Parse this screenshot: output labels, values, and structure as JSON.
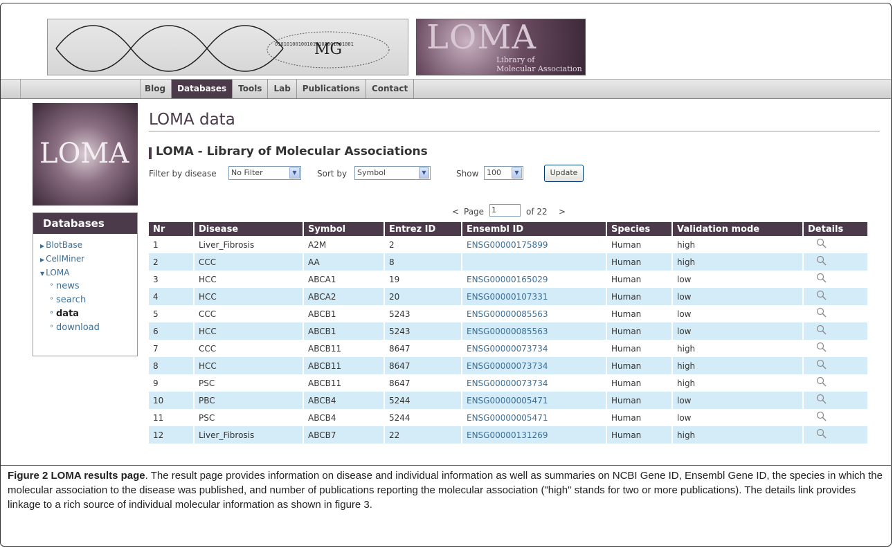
{
  "header": {
    "mg_logo_text": "MG",
    "mg_logo_binary": "010101001001010101001001001",
    "loma_banner_title": "LOMA",
    "loma_banner_sub1": "Library of",
    "loma_banner_sub2": "Molecular Association"
  },
  "nav": {
    "tabs": [
      {
        "label": "Blog"
      },
      {
        "label": "Databases"
      },
      {
        "label": "Tools"
      },
      {
        "label": "Lab"
      },
      {
        "label": "Publications"
      },
      {
        "label": "Contact"
      }
    ],
    "active": "Databases"
  },
  "sidebar": {
    "logo_text": "LOMA",
    "heading": "Databases",
    "items": [
      {
        "label": "BlotBase"
      },
      {
        "label": "CellMiner"
      },
      {
        "label": "LOMA"
      }
    ],
    "subitems": [
      {
        "label": "news"
      },
      {
        "label": "search"
      },
      {
        "label": "data"
      },
      {
        "label": "download"
      }
    ]
  },
  "main": {
    "page_title": "LOMA data",
    "subtitle": "LOMA - Library of Molecular Associations",
    "filter_label": "Filter by disease",
    "filter_value": "No Filter",
    "sort_label": "Sort by",
    "sort_value": "Symbol",
    "show_label": "Show",
    "show_value": "100",
    "update_label": "Update",
    "pager_prev": "<",
    "pager_page_label": "Page",
    "pager_page_value": "1",
    "pager_of": "of 22",
    "pager_next": ">"
  },
  "table": {
    "columns": [
      "Nr",
      "Disease",
      "Symbol",
      "Entrez ID",
      "Ensembl ID",
      "Species",
      "Validation mode",
      "Details"
    ],
    "rows": [
      [
        "1",
        "Liver_Fibrosis",
        "A2M",
        "2",
        "ENSG00000175899",
        "Human",
        "high"
      ],
      [
        "2",
        "CCC",
        "AA",
        "8",
        "",
        "Human",
        "high"
      ],
      [
        "3",
        "HCC",
        "ABCA1",
        "19",
        "ENSG00000165029",
        "Human",
        "low"
      ],
      [
        "4",
        "HCC",
        "ABCA2",
        "20",
        "ENSG00000107331",
        "Human",
        "low"
      ],
      [
        "5",
        "CCC",
        "ABCB1",
        "5243",
        "ENSG00000085563",
        "Human",
        "low"
      ],
      [
        "6",
        "HCC",
        "ABCB1",
        "5243",
        "ENSG00000085563",
        "Human",
        "low"
      ],
      [
        "7",
        "CCC",
        "ABCB11",
        "8647",
        "ENSG00000073734",
        "Human",
        "high"
      ],
      [
        "8",
        "HCC",
        "ABCB11",
        "8647",
        "ENSG00000073734",
        "Human",
        "high"
      ],
      [
        "9",
        "PSC",
        "ABCB11",
        "8647",
        "ENSG00000073734",
        "Human",
        "high"
      ],
      [
        "10",
        "PBC",
        "ABCB4",
        "5244",
        "ENSG00000005471",
        "Human",
        "low"
      ],
      [
        "11",
        "PSC",
        "ABCB4",
        "5244",
        "ENSG00000005471",
        "Human",
        "low"
      ],
      [
        "12",
        "Liver_Fibrosis",
        "ABCB7",
        "22",
        "ENSG00000131269",
        "Human",
        "high"
      ]
    ],
    "details_icon": "magnifier-icon"
  },
  "caption": {
    "label": "Figure 2 LOMA results page",
    "text": ". The result page provides information on disease and individual information as well as summaries on NCBI Gene ID, Ensembl Gene ID, the species in which the molecular association to the disease was published, and number of publications reporting the molecular association (\"high\" stands for two or more publications). The details link provides linkage to a rich source of individual molecular information as shown in figure 3."
  },
  "colors": {
    "header_purple": "#4a3a4a",
    "row_alt": "#d4ecf7",
    "link_blue": "#3a6e98"
  }
}
